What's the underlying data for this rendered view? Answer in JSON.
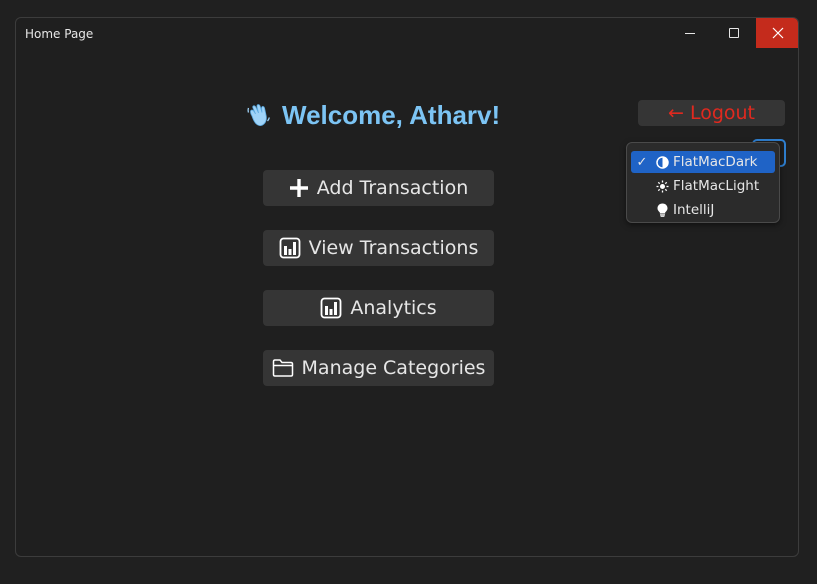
{
  "window": {
    "title": "Home Page"
  },
  "header": {
    "welcome": "Welcome, Atharv!",
    "welcome_icon": "waving-hand-icon",
    "accent_color": "#7cc4f4"
  },
  "menu": [
    {
      "label": "Add Transaction",
      "icon": "plus-icon"
    },
    {
      "label": "View Transactions",
      "icon": "bar-chart-icon"
    },
    {
      "label": "Analytics",
      "icon": "bar-chart-icon"
    },
    {
      "label": "Manage Categories",
      "icon": "folder-icon"
    }
  ],
  "logout": {
    "label": "← Logout",
    "color": "#e0291f"
  },
  "theme_selector": {
    "selected": "FlatMacDark",
    "options": [
      {
        "label": "FlatMacDark",
        "icon": "half-circle-icon",
        "checked": "✓"
      },
      {
        "label": "FlatMacLight",
        "icon": "sun-icon"
      },
      {
        "label": "IntelliJ",
        "icon": "lightbulb-icon"
      }
    ],
    "highlight_color": "#1f63c6"
  }
}
